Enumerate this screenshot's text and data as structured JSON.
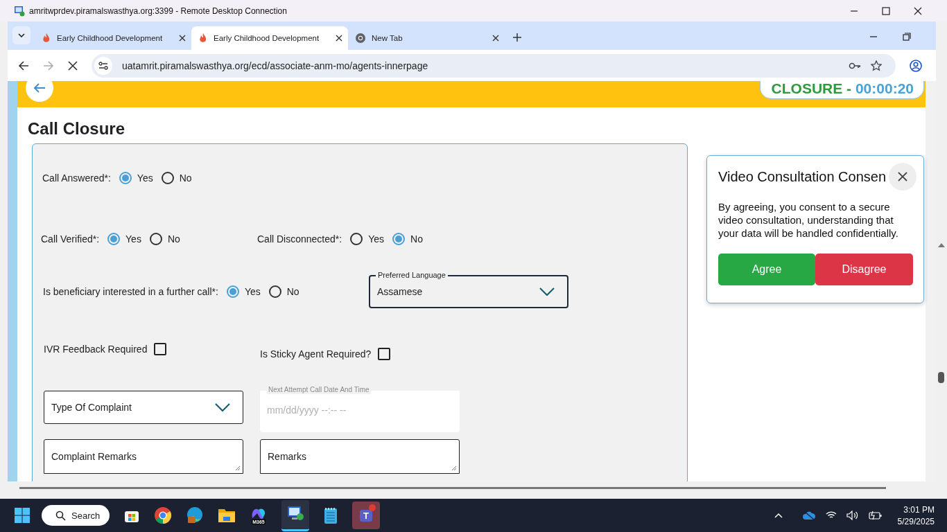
{
  "rdp_window": {
    "title": "amritwprdev.piramalswasthya.org:3399 - Remote Desktop Connection"
  },
  "browser": {
    "tabs": [
      {
        "title": "Early Childhood Development",
        "kind": "site",
        "selected": false
      },
      {
        "title": "Early Childhood Development",
        "kind": "site",
        "selected": true
      },
      {
        "title": "New Tab",
        "kind": "newtab",
        "selected": false
      }
    ],
    "url": "uatamrit.piramalswasthya.org/ecd/associate-anm-mo/agents-innerpage",
    "loading": true
  },
  "header": {
    "status": "CLOSURE -",
    "timer": "00:00:20"
  },
  "page_title": "Call Closure",
  "form": {
    "radio_groups": [
      {
        "label": "Call Answered*:",
        "options": [
          {
            "label": "Yes",
            "selected": true
          },
          {
            "label": "No",
            "selected": false
          }
        ]
      },
      {
        "label": "Call Verified*:",
        "options": [
          {
            "label": "Yes",
            "selected": true
          },
          {
            "label": "No",
            "selected": false
          }
        ]
      },
      {
        "label": "Call Disconnected*:",
        "options": [
          {
            "label": "Yes",
            "selected": false
          },
          {
            "label": "No",
            "selected": true
          }
        ]
      },
      {
        "label": "Is beneficiary interested in a further call*:",
        "options": [
          {
            "label": "Yes",
            "selected": true
          },
          {
            "label": "No",
            "selected": false
          }
        ]
      }
    ],
    "preferred_language": {
      "label": "Preferred Language",
      "value": "Assamese"
    },
    "checkboxes": [
      {
        "label": "IVR Feedback Required",
        "checked": false
      },
      {
        "label": "Is Sticky Agent Required?",
        "checked": false
      }
    ],
    "type_of_complaint": {
      "placeholder": "Type Of Complaint"
    },
    "next_attempt": {
      "label": "Next Attempt Call Date And Time",
      "placeholder": "mm/dd/yyyy --:-- --",
      "disabled": true
    },
    "complaint_remarks": {
      "placeholder": "Complaint Remarks"
    },
    "remarks": {
      "placeholder": "Remarks"
    }
  },
  "consent_dialog": {
    "title": "Video Consultation Consen",
    "message": "By agreeing, you consent to a secure video consultation, understanding that your data will be handled confidentially.",
    "buttons": [
      {
        "label": "Agree",
        "kind": "accept"
      },
      {
        "label": "Disagree",
        "kind": "decline"
      }
    ]
  },
  "taskbar": {
    "search": "Search",
    "m365_label": "M365",
    "teams_label": "T",
    "clock": {
      "time": "3:01 PM",
      "date": "5/29/2025"
    }
  }
}
